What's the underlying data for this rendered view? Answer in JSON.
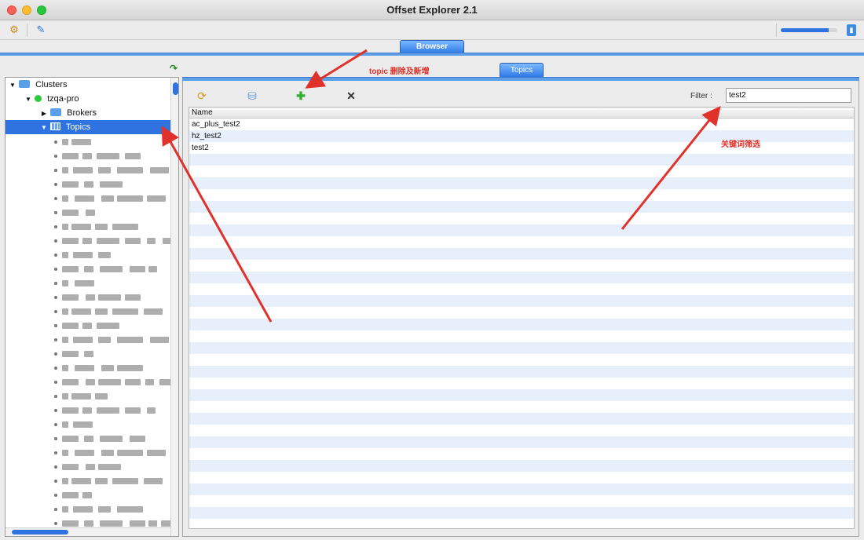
{
  "window": {
    "title": "Offset Explorer  2.1"
  },
  "toolbar": {
    "buttons": [
      {
        "name": "connection-tool-icon",
        "glyph": "⚙"
      },
      {
        "name": "edit-tool-icon",
        "glyph": "✎"
      }
    ],
    "progress_value": 0.85
  },
  "main_tab": {
    "label": "Browser"
  },
  "tree": {
    "root": "Clusters",
    "cluster": "tzqa-pro",
    "brokers": "Brokers",
    "topics": "Topics"
  },
  "topics_tab": {
    "label": "Topics"
  },
  "topics_panel": {
    "filter_label": "Filter :",
    "filter_value": "test2",
    "column_header": "Name",
    "rows": [
      "ac_plus_test2",
      "hz_test2",
      "test2"
    ]
  },
  "annotations": {
    "topic_ops": "topic 删除及新增",
    "keyword_filter": "关键词筛选"
  },
  "colors": {
    "accent": "#2f73e0",
    "annotation": "#e0322b"
  }
}
